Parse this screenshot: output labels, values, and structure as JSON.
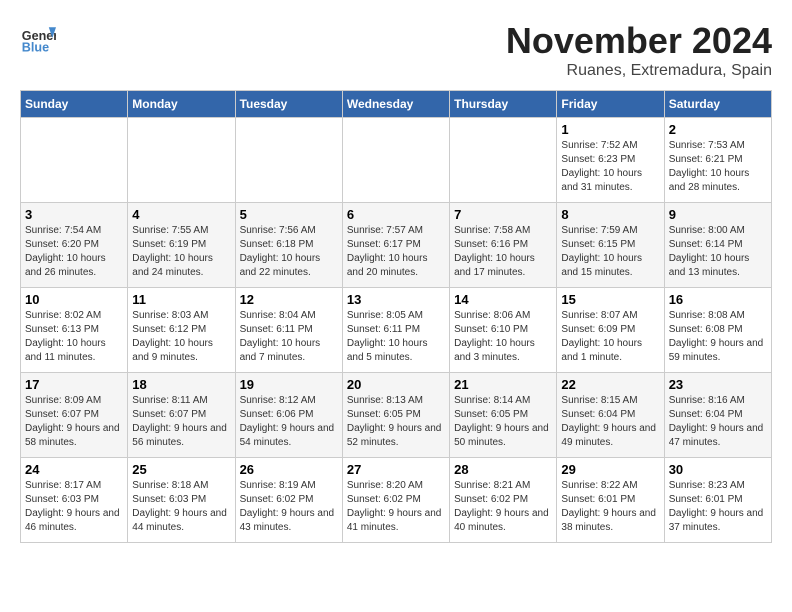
{
  "logo": {
    "general": "General",
    "blue": "Blue"
  },
  "header": {
    "month": "November 2024",
    "location": "Ruanes, Extremadura, Spain"
  },
  "weekdays": [
    "Sunday",
    "Monday",
    "Tuesday",
    "Wednesday",
    "Thursday",
    "Friday",
    "Saturday"
  ],
  "weeks": [
    [
      {
        "day": "",
        "info": ""
      },
      {
        "day": "",
        "info": ""
      },
      {
        "day": "",
        "info": ""
      },
      {
        "day": "",
        "info": ""
      },
      {
        "day": "",
        "info": ""
      },
      {
        "day": "1",
        "info": "Sunrise: 7:52 AM\nSunset: 6:23 PM\nDaylight: 10 hours and 31 minutes."
      },
      {
        "day": "2",
        "info": "Sunrise: 7:53 AM\nSunset: 6:21 PM\nDaylight: 10 hours and 28 minutes."
      }
    ],
    [
      {
        "day": "3",
        "info": "Sunrise: 7:54 AM\nSunset: 6:20 PM\nDaylight: 10 hours and 26 minutes."
      },
      {
        "day": "4",
        "info": "Sunrise: 7:55 AM\nSunset: 6:19 PM\nDaylight: 10 hours and 24 minutes."
      },
      {
        "day": "5",
        "info": "Sunrise: 7:56 AM\nSunset: 6:18 PM\nDaylight: 10 hours and 22 minutes."
      },
      {
        "day": "6",
        "info": "Sunrise: 7:57 AM\nSunset: 6:17 PM\nDaylight: 10 hours and 20 minutes."
      },
      {
        "day": "7",
        "info": "Sunrise: 7:58 AM\nSunset: 6:16 PM\nDaylight: 10 hours and 17 minutes."
      },
      {
        "day": "8",
        "info": "Sunrise: 7:59 AM\nSunset: 6:15 PM\nDaylight: 10 hours and 15 minutes."
      },
      {
        "day": "9",
        "info": "Sunrise: 8:00 AM\nSunset: 6:14 PM\nDaylight: 10 hours and 13 minutes."
      }
    ],
    [
      {
        "day": "10",
        "info": "Sunrise: 8:02 AM\nSunset: 6:13 PM\nDaylight: 10 hours and 11 minutes."
      },
      {
        "day": "11",
        "info": "Sunrise: 8:03 AM\nSunset: 6:12 PM\nDaylight: 10 hours and 9 minutes."
      },
      {
        "day": "12",
        "info": "Sunrise: 8:04 AM\nSunset: 6:11 PM\nDaylight: 10 hours and 7 minutes."
      },
      {
        "day": "13",
        "info": "Sunrise: 8:05 AM\nSunset: 6:11 PM\nDaylight: 10 hours and 5 minutes."
      },
      {
        "day": "14",
        "info": "Sunrise: 8:06 AM\nSunset: 6:10 PM\nDaylight: 10 hours and 3 minutes."
      },
      {
        "day": "15",
        "info": "Sunrise: 8:07 AM\nSunset: 6:09 PM\nDaylight: 10 hours and 1 minute."
      },
      {
        "day": "16",
        "info": "Sunrise: 8:08 AM\nSunset: 6:08 PM\nDaylight: 9 hours and 59 minutes."
      }
    ],
    [
      {
        "day": "17",
        "info": "Sunrise: 8:09 AM\nSunset: 6:07 PM\nDaylight: 9 hours and 58 minutes."
      },
      {
        "day": "18",
        "info": "Sunrise: 8:11 AM\nSunset: 6:07 PM\nDaylight: 9 hours and 56 minutes."
      },
      {
        "day": "19",
        "info": "Sunrise: 8:12 AM\nSunset: 6:06 PM\nDaylight: 9 hours and 54 minutes."
      },
      {
        "day": "20",
        "info": "Sunrise: 8:13 AM\nSunset: 6:05 PM\nDaylight: 9 hours and 52 minutes."
      },
      {
        "day": "21",
        "info": "Sunrise: 8:14 AM\nSunset: 6:05 PM\nDaylight: 9 hours and 50 minutes."
      },
      {
        "day": "22",
        "info": "Sunrise: 8:15 AM\nSunset: 6:04 PM\nDaylight: 9 hours and 49 minutes."
      },
      {
        "day": "23",
        "info": "Sunrise: 8:16 AM\nSunset: 6:04 PM\nDaylight: 9 hours and 47 minutes."
      }
    ],
    [
      {
        "day": "24",
        "info": "Sunrise: 8:17 AM\nSunset: 6:03 PM\nDaylight: 9 hours and 46 minutes."
      },
      {
        "day": "25",
        "info": "Sunrise: 8:18 AM\nSunset: 6:03 PM\nDaylight: 9 hours and 44 minutes."
      },
      {
        "day": "26",
        "info": "Sunrise: 8:19 AM\nSunset: 6:02 PM\nDaylight: 9 hours and 43 minutes."
      },
      {
        "day": "27",
        "info": "Sunrise: 8:20 AM\nSunset: 6:02 PM\nDaylight: 9 hours and 41 minutes."
      },
      {
        "day": "28",
        "info": "Sunrise: 8:21 AM\nSunset: 6:02 PM\nDaylight: 9 hours and 40 minutes."
      },
      {
        "day": "29",
        "info": "Sunrise: 8:22 AM\nSunset: 6:01 PM\nDaylight: 9 hours and 38 minutes."
      },
      {
        "day": "30",
        "info": "Sunrise: 8:23 AM\nSunset: 6:01 PM\nDaylight: 9 hours and 37 minutes."
      }
    ]
  ]
}
